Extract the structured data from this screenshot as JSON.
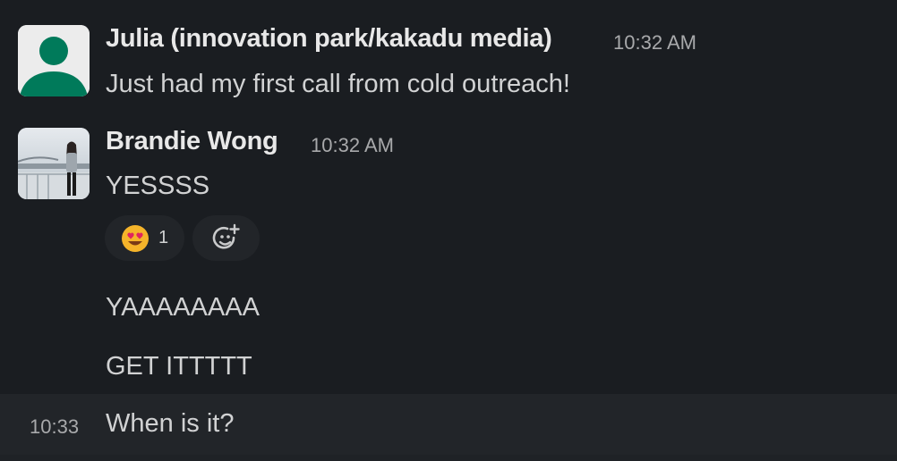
{
  "messages": [
    {
      "sender": "Julia (innovation park/kakadu media)",
      "time": "10:32 AM",
      "text": "Just had my first call from cold outreach!",
      "avatar_icon": "default-user-avatar"
    },
    {
      "sender": "Brandie Wong",
      "time": "10:32 AM",
      "text": "YESSSS",
      "avatar_icon": "photo-avatar",
      "reactions": [
        {
          "emoji": "heart-eyes-emoji",
          "count": "1"
        }
      ],
      "add_reaction_icon": "add-reaction-icon"
    }
  ],
  "followups": [
    {
      "text": "YAAAAAAAA"
    },
    {
      "text": "GET ITTTTT"
    },
    {
      "time": "10:33",
      "text": "When is it?"
    }
  ],
  "colors": {
    "background": "#1a1d21",
    "hover_row": "#222529",
    "default_avatar_green": "#007a5a",
    "text": "#d1d2d3",
    "timestamp": "#a8a9ab"
  }
}
